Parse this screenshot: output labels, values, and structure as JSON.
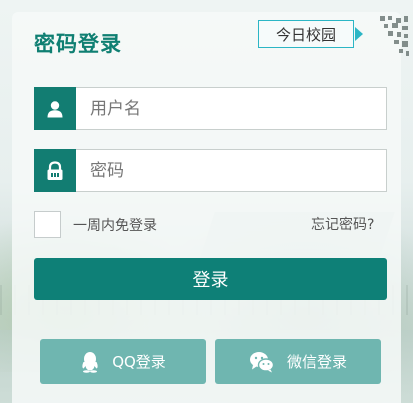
{
  "login": {
    "title": "密码登录",
    "campus_tag": "今日校园",
    "username_placeholder": "用户名",
    "password_placeholder": "密码",
    "remember_label": "一周内免登录",
    "forgot_label": "忘记密码?",
    "submit_label": "登录",
    "qq_label": "QQ登录",
    "wechat_label": "微信登录"
  },
  "colors": {
    "primary": "#0e8077",
    "title": "#0f7f72",
    "social_button": "#6fb6b0",
    "tag_border": "#2bb6c5"
  },
  "icons": [
    "user-icon",
    "lock-icon",
    "qq-icon",
    "wechat-icon",
    "qr-code-icon",
    "arrow-right-icon"
  ]
}
